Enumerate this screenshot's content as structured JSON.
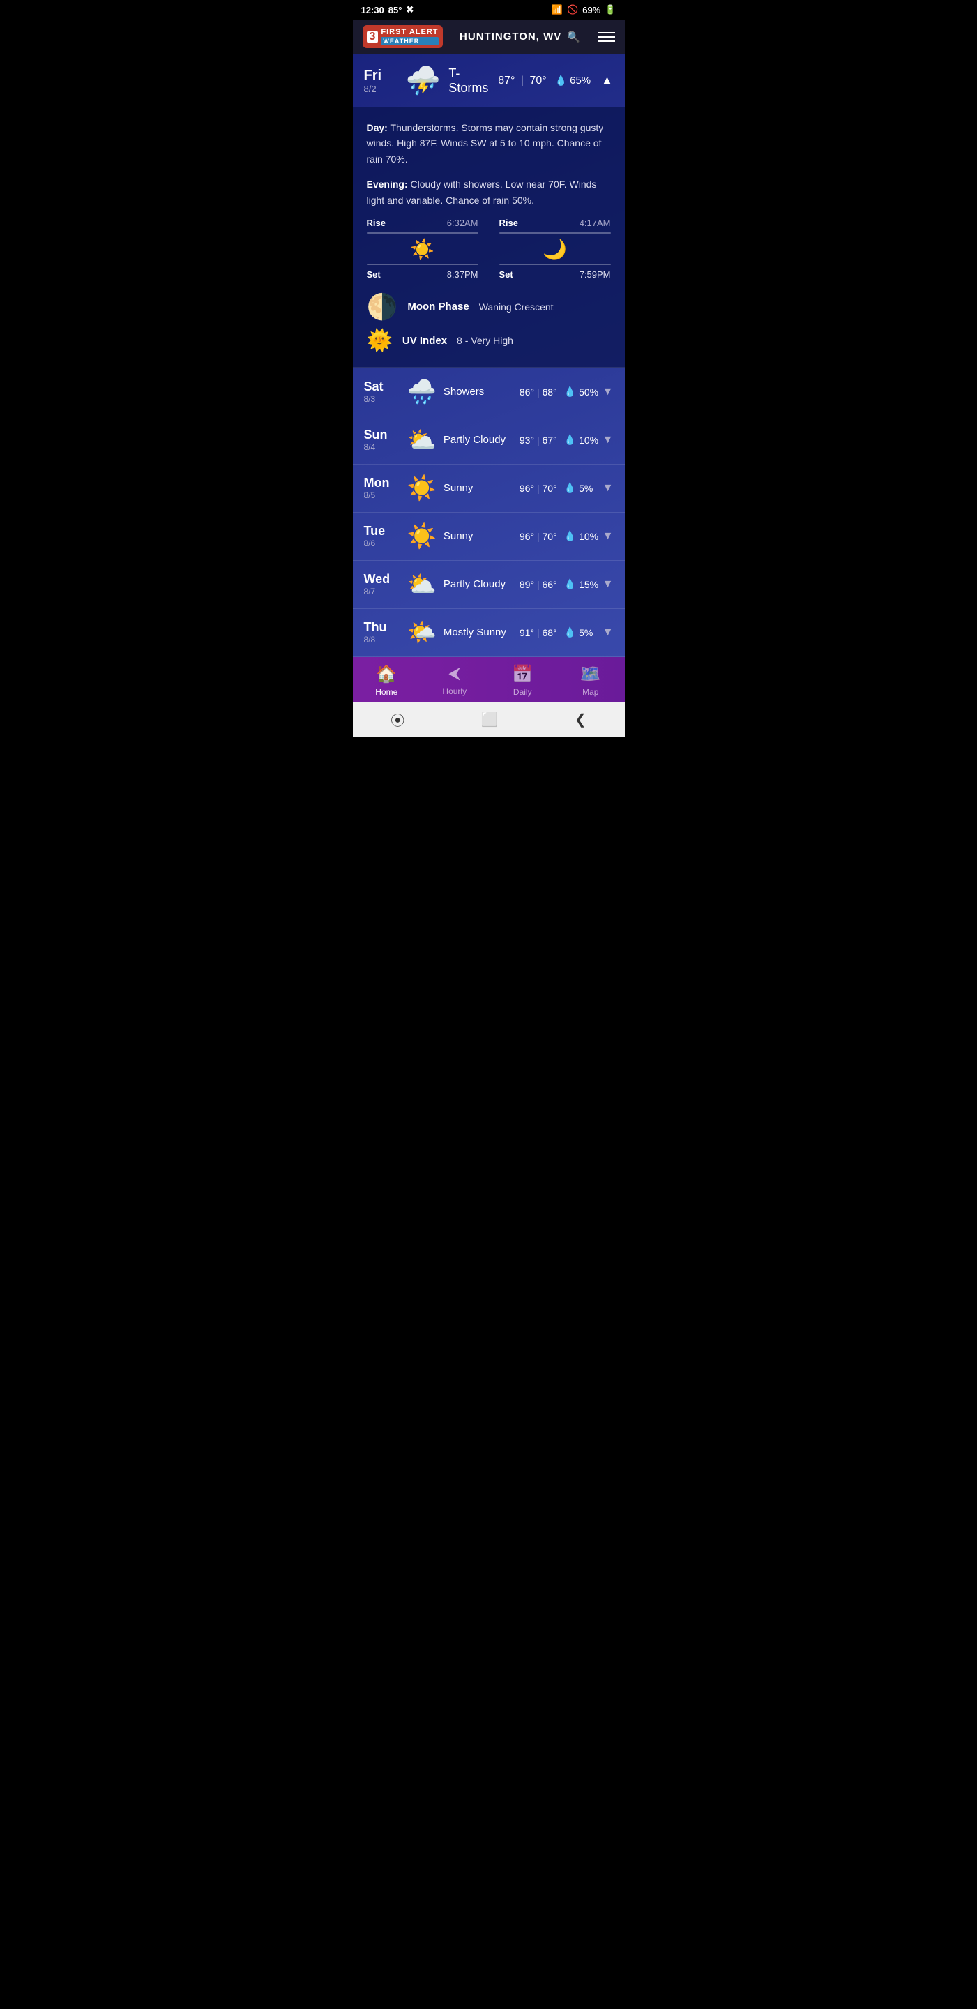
{
  "statusBar": {
    "time": "12:30",
    "temp": "85°",
    "battery": "69%"
  },
  "header": {
    "logoNum": "3",
    "logoFirst": "FIRST ALERT",
    "logoWeather": "WEATHER",
    "location": "HUNTINGTON, WV",
    "searchIcon": "🔍",
    "menuIcon": "☰"
  },
  "today": {
    "day": "Fri",
    "date": "8/2",
    "icon": "⛈️",
    "condition": "T-Storms",
    "highTemp": "87°",
    "lowTemp": "70°",
    "precip": "65%",
    "chevron": "▲",
    "expanded": true
  },
  "detail": {
    "dayText": "Day:",
    "dayDesc": "Thunderstorms. Storms may contain strong gusty winds. High 87F. Winds SW at 5 to 10 mph. Chance of rain 70%.",
    "eveningText": "Evening:",
    "eveningDesc": "Cloudy with showers. Low near 70F. Winds light and variable. Chance of rain 50%.",
    "sunRiseLabel": "Rise",
    "sunRise": "6:32AM",
    "sunSetLabel": "Set",
    "sunSet": "8:37PM",
    "moonRise": "4:17AM",
    "moonSet": "7:59PM",
    "moonPhaseLabel": "Moon Phase",
    "moonPhase": "Waning Crescent",
    "uvLabel": "UV Index",
    "uvValue": "8 - Very High"
  },
  "forecast": [
    {
      "day": "Sat",
      "date": "8/3",
      "icon": "🌧️",
      "condition": "Showers",
      "highTemp": "86°",
      "lowTemp": "68°",
      "precip": "50%"
    },
    {
      "day": "Sun",
      "date": "8/4",
      "icon": "⛅",
      "condition": "Partly Cloudy",
      "highTemp": "93°",
      "lowTemp": "67°",
      "precip": "10%"
    },
    {
      "day": "Mon",
      "date": "8/5",
      "icon": "☀️",
      "condition": "Sunny",
      "highTemp": "96°",
      "lowTemp": "70°",
      "precip": "5%"
    },
    {
      "day": "Tue",
      "date": "8/6",
      "icon": "☀️",
      "condition": "Sunny",
      "highTemp": "96°",
      "lowTemp": "70°",
      "precip": "10%"
    },
    {
      "day": "Wed",
      "date": "8/7",
      "icon": "⛅",
      "condition": "Partly Cloudy",
      "highTemp": "89°",
      "lowTemp": "66°",
      "precip": "15%"
    },
    {
      "day": "Thu",
      "date": "8/8",
      "icon": "🌤️",
      "condition": "Mostly Sunny",
      "highTemp": "91°",
      "lowTemp": "68°",
      "precip": "5%"
    }
  ],
  "bottomNav": [
    {
      "icon": "🏠",
      "label": "Home",
      "active": true
    },
    {
      "icon": "◀",
      "label": "Hourly",
      "active": false
    },
    {
      "icon": "📅",
      "label": "Daily",
      "active": false
    },
    {
      "icon": "🗺️",
      "label": "Map",
      "active": false
    }
  ],
  "androidNav": {
    "back": "❮",
    "home": "⬜",
    "recent": "⦿"
  }
}
